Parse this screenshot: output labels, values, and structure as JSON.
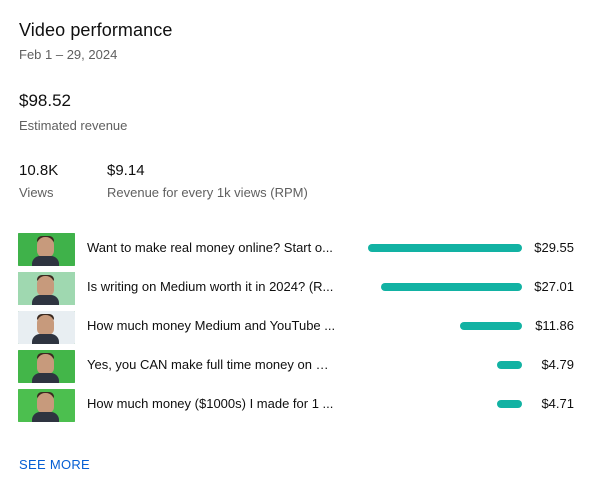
{
  "card": {
    "title": "Video performance",
    "date_range": "Feb 1 – 29, 2024"
  },
  "revenue": {
    "value": "$98.52",
    "label": "Estimated revenue"
  },
  "metrics": [
    {
      "value": "10.8K",
      "label": "Views"
    },
    {
      "value": "$9.14",
      "label": "Revenue for every 1k views (RPM)"
    }
  ],
  "videos": [
    {
      "title": "Want to make real money online? Start o...",
      "amount": "$29.55",
      "revenue": 29.55,
      "thumb_color": "#3fb24a",
      "thumb_icon": "person-green-background-icon"
    },
    {
      "title": "Is writing on Medium worth it in 2024? (R...",
      "amount": "$27.01",
      "revenue": 27.01,
      "thumb_color": "#9fd8b0",
      "thumb_icon": "person-chart-background-icon"
    },
    {
      "title": "How much money Medium and YouTube ...",
      "amount": "$11.86",
      "revenue": 11.86,
      "thumb_color": "#e8eef2",
      "thumb_icon": "person-light-background-icon"
    },
    {
      "title": "Yes, you CAN make full time money on M...",
      "amount": "$4.79",
      "revenue": 4.79,
      "thumb_color": "#43b649",
      "thumb_icon": "person-dollar-sign-icon"
    },
    {
      "title": "How much money ($1000s) I made for 1 ...",
      "amount": "$4.71",
      "revenue": 4.71,
      "thumb_color": "#4cbf4f",
      "thumb_icon": "person-green-background-icon"
    }
  ],
  "bar_color": "#12b2a3",
  "see_more": "SEE MORE"
}
